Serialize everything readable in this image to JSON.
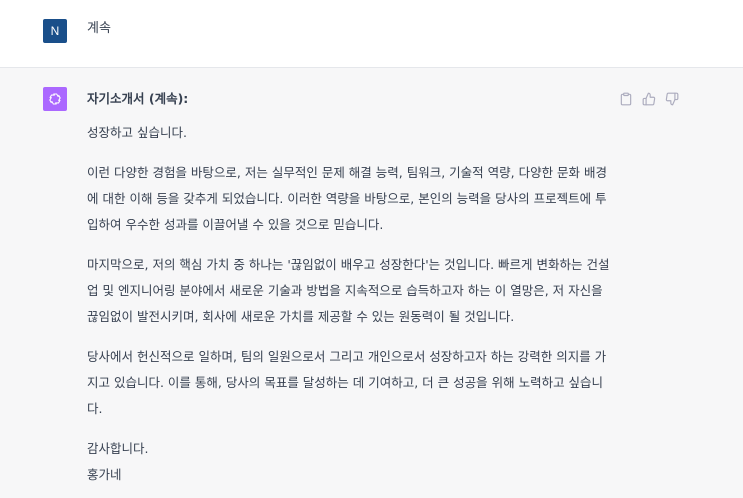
{
  "user_message": {
    "avatar_letter": "N",
    "text": "계속"
  },
  "assistant_message": {
    "title": "자기소개서 (계속):",
    "paragraphs": [
      "성장하고 싶습니다.",
      "이런 다양한 경험을 바탕으로, 저는 실무적인 문제 해결 능력, 팀워크, 기술적 역량, 다양한 문화 배경에 대한 이해 등을 갖추게 되었습니다. 이러한 역량을 바탕으로, 본인의 능력을 당사의 프로젝트에 투입하여 우수한 성과를 이끌어낼 수 있을 것으로 믿습니다.",
      "마지막으로, 저의 핵심 가치 중 하나는 '끊임없이 배우고 성장한다'는 것입니다. 빠르게 변화하는 건설업 및 엔지니어링 분야에서 새로운 기술과 방법을 지속적으로 습득하고자 하는 이 열망은, 저 자신을 끊임없이 발전시키며, 회사에 새로운 가치를 제공할 수 있는 원동력이 될 것입니다.",
      "당사에서 헌신적으로 일하며, 팀의 일원으로서 그리고 개인으로서 성장하고자 하는 강력한 의지를 가지고 있습니다. 이를 통해, 당사의 목표를 달성하는 데 기여하고, 더 큰 성공을 위해 노력하고 싶습니다."
    ],
    "closing": "감사합니다.",
    "signature": "홍가네"
  },
  "actions": {
    "copy_icon": "clipboard-icon",
    "like_icon": "thumbs-up-icon",
    "dislike_icon": "thumbs-down-icon"
  },
  "colors": {
    "user_avatar_bg": "#1a4f8a",
    "assistant_avatar_bg": "#ab68ff",
    "assistant_row_bg": "#f7f7f8",
    "icon_gray": "#acacbe"
  }
}
